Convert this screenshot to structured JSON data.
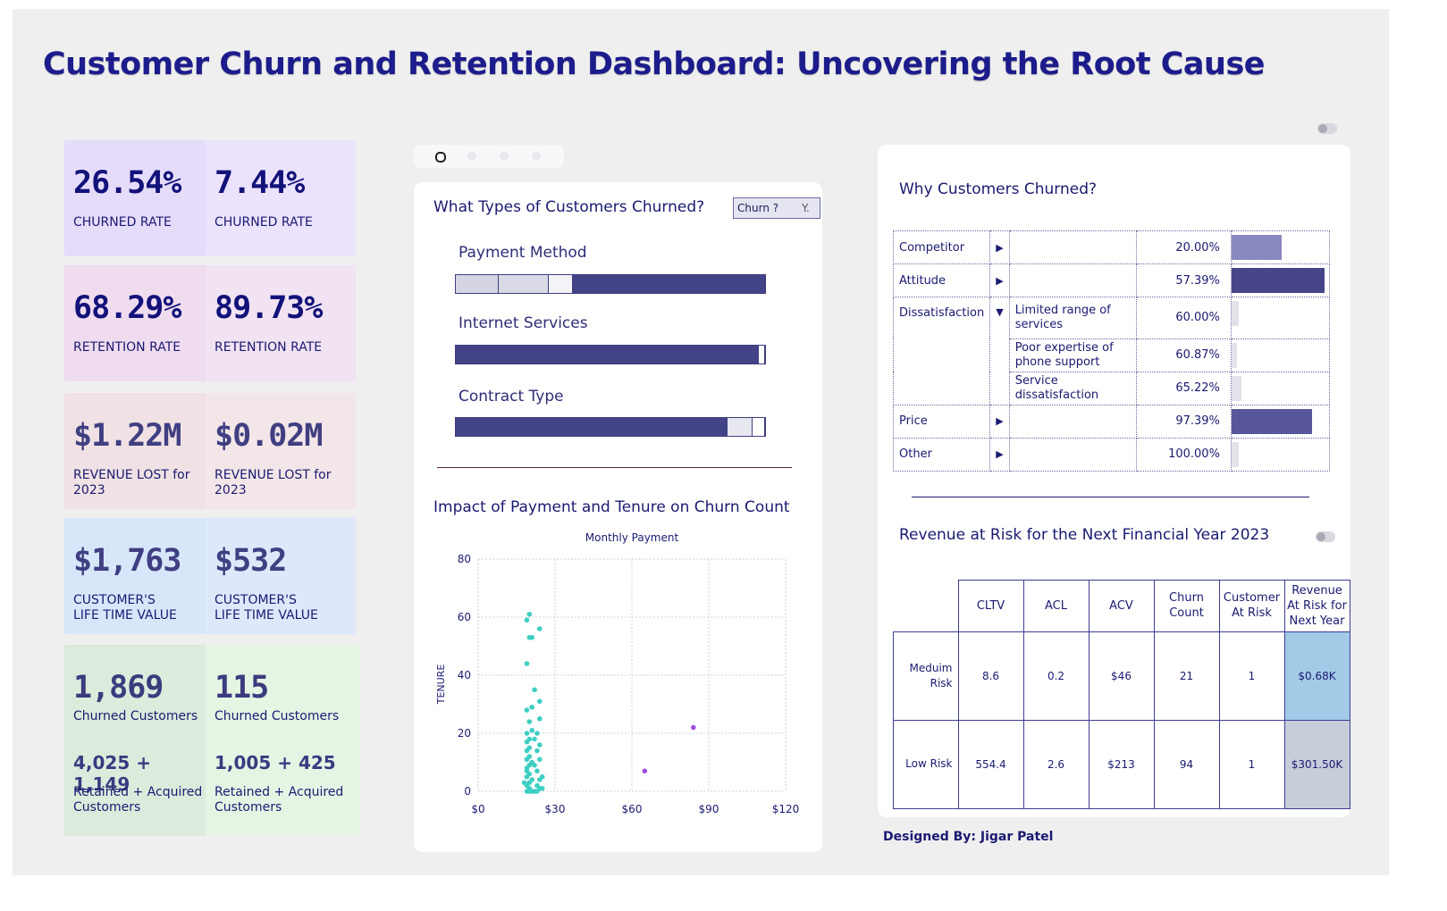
{
  "title": "Customer Churn and Retention Dashboard: Uncovering the Root Cause",
  "kpis": [
    {
      "value_a": "26.54%",
      "value_b": "7.44%",
      "label": "CHURNED RATE"
    },
    {
      "value_a": "68.29%",
      "value_b": "89.73%",
      "label": "RETENTION RATE"
    },
    {
      "value_a": "$1.22M",
      "value_b": "$0.02M",
      "label_line1": "REVENUE LOST for",
      "label_line2": "2023"
    },
    {
      "value_a": "$1,763",
      "value_b": "$532",
      "label_line1": "CUSTOMER'S",
      "label_line2": "LIFE TIME VALUE"
    },
    {
      "value_a": "1,869",
      "value_b": "115",
      "label": "Churned Customers",
      "sub_a": "4,025 + 1,149",
      "sub_b": "1,005 + 425",
      "sub_line1": "Retained + Acquired",
      "sub_line2": "Customers"
    }
  ],
  "types_panel": {
    "title": "What Types of Customers Churned?",
    "filter_label": "Churn ?",
    "filter_value": "Y.",
    "bars": [
      {
        "label": "Payment Method",
        "segments": [
          0.14,
          0.16,
          0.08,
          0.62
        ]
      },
      {
        "label": "Internet Services",
        "segments": [
          0.98,
          0.02
        ]
      },
      {
        "label": "Contract Type",
        "segments": [
          0.88,
          0.08,
          0.04
        ]
      }
    ]
  },
  "scatter": {
    "title": "Impact of Payment and Tenure on Churn Count",
    "chart_data": {
      "type": "scatter",
      "title": "Monthly Payment",
      "xlabel": "Monthly Payment",
      "ylabel": "TENURE",
      "xlim": [
        0,
        120
      ],
      "ylim": [
        0,
        80
      ],
      "x_ticks": [
        "$0",
        "$30",
        "$60",
        "$90",
        "$120"
      ],
      "y_ticks": [
        "0",
        "20",
        "40",
        "60",
        "80"
      ],
      "series": [
        {
          "color": "#3ecfc4",
          "points": [
            [
              19,
              0
            ],
            [
              20,
              1
            ],
            [
              19,
              2
            ],
            [
              20,
              3
            ],
            [
              21,
              4
            ],
            [
              19,
              5
            ],
            [
              20,
              6
            ],
            [
              19,
              7
            ],
            [
              19,
              8
            ],
            [
              20,
              9
            ],
            [
              21,
              10
            ],
            [
              19,
              11
            ],
            [
              20,
              12
            ],
            [
              19,
              14
            ],
            [
              20,
              15
            ],
            [
              19,
              17
            ],
            [
              20,
              18
            ],
            [
              19,
              20
            ],
            [
              21,
              21
            ],
            [
              24,
              1
            ],
            [
              23,
              2
            ],
            [
              24,
              4
            ],
            [
              25,
              5
            ],
            [
              23,
              7
            ],
            [
              22,
              9
            ],
            [
              24,
              11
            ],
            [
              23,
              14
            ],
            [
              24,
              16
            ],
            [
              22,
              18
            ],
            [
              23,
              20
            ],
            [
              20,
              24
            ],
            [
              24,
              25
            ],
            [
              19,
              28
            ],
            [
              21,
              29
            ],
            [
              24,
              31
            ],
            [
              22,
              35
            ],
            [
              19,
              44
            ],
            [
              21,
              53
            ],
            [
              20,
              53
            ],
            [
              24,
              56
            ],
            [
              19,
              59
            ],
            [
              20,
              61
            ],
            [
              25,
              1
            ],
            [
              18,
              3
            ],
            [
              22,
              0
            ],
            [
              23,
              0
            ],
            [
              21,
              0
            ],
            [
              20,
              0
            ]
          ]
        },
        {
          "color": "#a14fe0",
          "points": [
            [
              65,
              7
            ],
            [
              84,
              22
            ]
          ]
        }
      ]
    }
  },
  "why": {
    "title": "Why Customers Churned?",
    "rows": [
      {
        "reason": "Competitor",
        "arrow": "▶",
        "sub": "",
        "pct": "20.00%",
        "bar": 0.2,
        "color": "#8a88c0"
      },
      {
        "reason": "Attitude",
        "arrow": "▶",
        "sub": "",
        "pct": "57.39%",
        "bar": 0.37,
        "color": "#474589"
      },
      {
        "reason": "Dissatisfaction",
        "arrow": "▼",
        "sub": "Limited range of services",
        "pct": "60.00%",
        "bar": 0.03,
        "color": "#e2e2ea"
      },
      {
        "reason": "",
        "arrow": "",
        "sub": "Poor expertise of phone support",
        "pct": "60.87%",
        "bar": 0.01,
        "color": "#e2e2ea"
      },
      {
        "reason": "",
        "arrow": "",
        "sub": "Service dissatisfaction",
        "pct": "65.22%",
        "bar": 0.04,
        "color": "#e2e2ea"
      },
      {
        "reason": "Price",
        "arrow": "▶",
        "sub": "",
        "pct": "97.39%",
        "bar": 0.32,
        "color": "#58569a"
      },
      {
        "reason": "Other",
        "arrow": "▶",
        "sub": "",
        "pct": "100.00%",
        "bar": 0.03,
        "color": "#e2e2ea"
      }
    ]
  },
  "revenue": {
    "title": "Revenue at Risk for the Next Financial Year 2023",
    "headers": [
      "CLTV",
      "ACL",
      "ACV",
      "Churn Count",
      "Customer At Risk",
      "Revenue At Risk for Next Year"
    ],
    "rows": [
      {
        "segment": "Meduim Risk",
        "cltv": "8.6",
        "acl": "0.2",
        "acv": "$46",
        "churn": "21",
        "at_risk": "1",
        "revenue": "$0.68K",
        "color": "#a3cbe8"
      },
      {
        "segment": "Low Risk",
        "cltv": "554.4",
        "acl": "2.6",
        "acv": "$213",
        "churn": "94",
        "at_risk": "1",
        "revenue": "$301.50K",
        "color": "#c8cdda"
      }
    ]
  },
  "footer": "Designed By: Jigar Patel"
}
